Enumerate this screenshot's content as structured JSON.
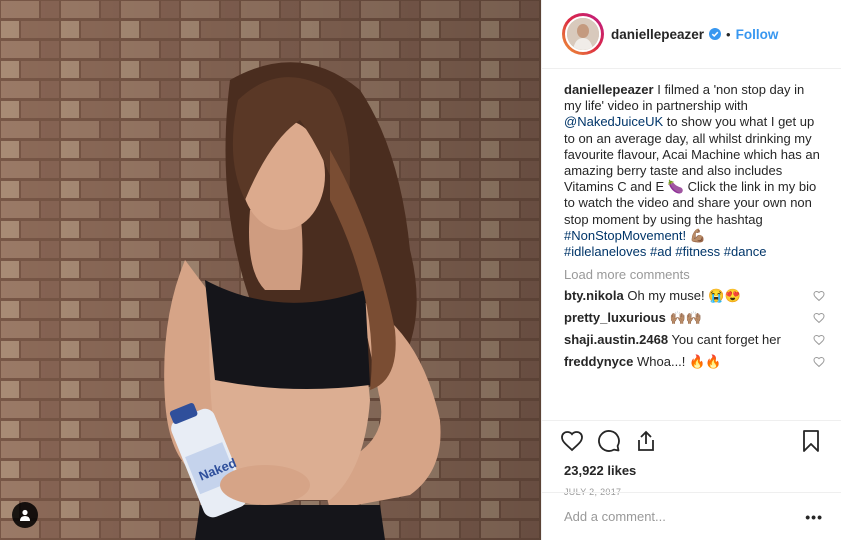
{
  "post": {
    "username": "daniellepeazer",
    "follow_label": "Follow",
    "separator": "•",
    "caption": {
      "username": "daniellepeazer",
      "text_before_mention": " I filmed a 'non stop day in my life' video in partnership with ",
      "mention": "@NakedJuiceUK",
      "text_after_mention": " to show you what I get up to on an average day, all whilst drinking my favourite flavour, Acai Machine which has an amazing berry taste and also includes Vitamins C and E 🍆 Click the link in my bio to watch the video and share your own non stop moment by using the hashtag ",
      "hashtag_main": "#NonStopMovement!",
      "text_after_hashtag": " 💪🏽 ",
      "hashtags": [
        "#idlelaneloves",
        "#ad",
        "#fitness",
        "#dance"
      ]
    },
    "load_more_label": "Load more comments",
    "comments": [
      {
        "username": "bty.nikola",
        "text": "Oh my muse! 😭😍"
      },
      {
        "username": "pretty_luxurious",
        "text": "🙌🏽🙌🏽"
      },
      {
        "username": "shaji.austin.2468",
        "text": "You cant forget her"
      },
      {
        "username": "freddynyce",
        "text": "Whoa...! 🔥🔥"
      }
    ],
    "likes": "23,922 likes",
    "date": "JULY 2, 2017",
    "add_comment_placeholder": "Add a comment...",
    "more_label": "•••"
  },
  "icons": {
    "verified": "verified-badge-icon",
    "heart": "heart-icon",
    "comment": "comment-icon",
    "share": "share-icon",
    "save": "bookmark-icon",
    "user_tag": "person-icon"
  },
  "colors": {
    "accent": "#3897f0",
    "link": "#003569",
    "muted": "#999999",
    "border": "#efefef"
  }
}
